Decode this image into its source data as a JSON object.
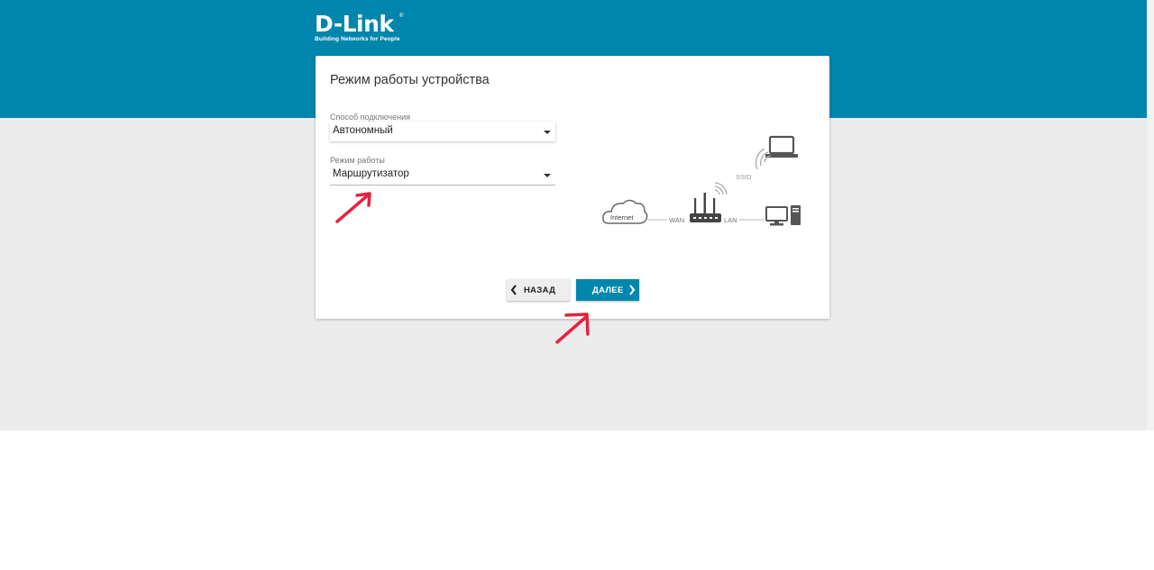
{
  "header": {
    "logo_text": "D-Link",
    "logo_registered": "®",
    "logo_tagline": "Building Networks for People"
  },
  "panel": {
    "title": "Режим работы устройства",
    "connection_method": {
      "label": "Способ подключения",
      "value": "Автономный"
    },
    "operation_mode": {
      "label": "Режим работы",
      "value": "Маршрутизатор"
    },
    "diagram": {
      "internet": "Internet",
      "wan": "WAN",
      "lan": "LAN",
      "ssid": "SSID"
    },
    "buttons": {
      "back": "НАЗАД",
      "next": "ДАЛЕЕ"
    }
  },
  "colors": {
    "brand": "#0086ad",
    "background_grey": "#ececec",
    "annotation": "#e5213f"
  },
  "icons": [
    "chevron-left-icon",
    "chevron-right-icon",
    "caret-down-icon",
    "cloud-icon",
    "router-icon",
    "laptop-icon",
    "desktop-icon",
    "wifi-icon"
  ]
}
